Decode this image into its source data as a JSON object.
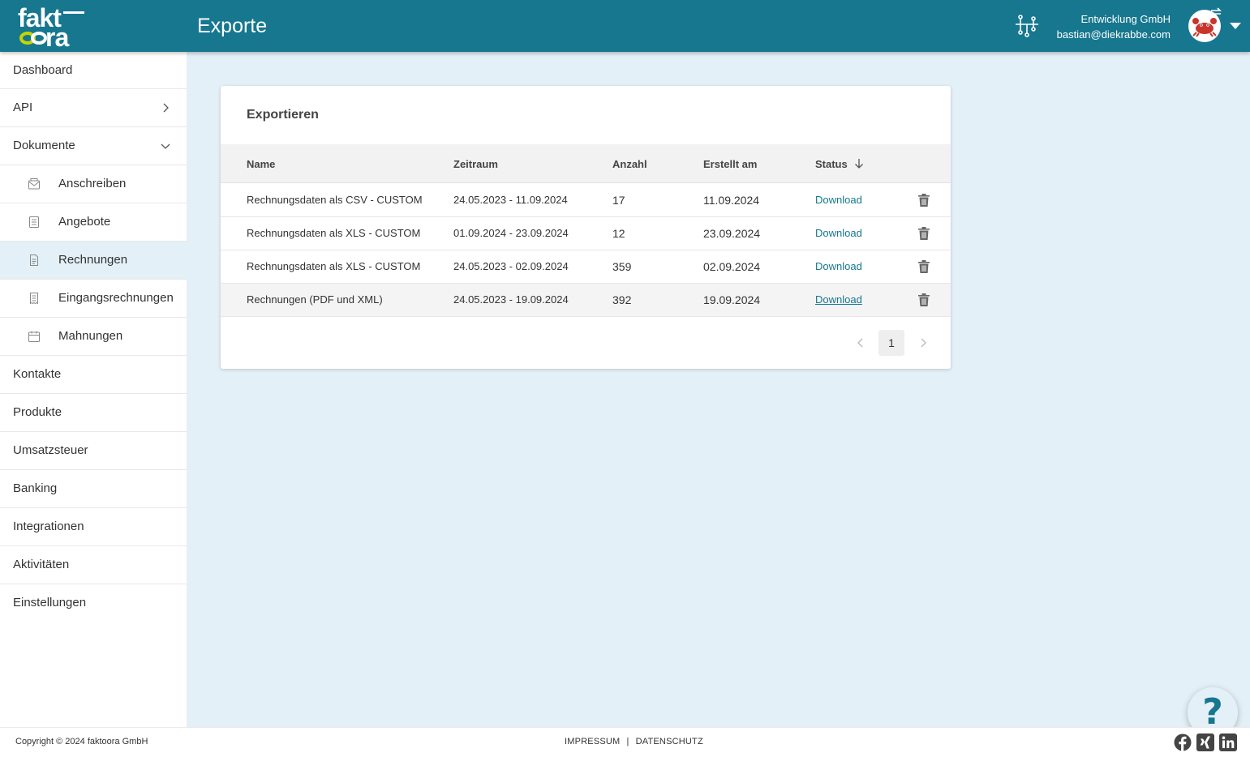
{
  "header": {
    "logo_top": "fakt",
    "logo_bottom": "ra",
    "page_title": "Exporte",
    "company": "Entwicklung GmbH",
    "email": "bastian@diekrabbe.com"
  },
  "sidebar": {
    "items": [
      {
        "label": "Dashboard"
      },
      {
        "label": "API"
      },
      {
        "label": "Dokumente"
      },
      {
        "label": "Anschreiben"
      },
      {
        "label": "Angebote"
      },
      {
        "label": "Rechnungen"
      },
      {
        "label": "Eingangsrechnungen"
      },
      {
        "label": "Mahnungen"
      },
      {
        "label": "Kontakte"
      },
      {
        "label": "Produkte"
      },
      {
        "label": "Umsatzsteuer"
      },
      {
        "label": "Banking"
      },
      {
        "label": "Integrationen"
      },
      {
        "label": "Aktivitäten"
      },
      {
        "label": "Einstellungen"
      }
    ]
  },
  "card": {
    "title": "Exportieren",
    "columns": {
      "name": "Name",
      "zeitraum": "Zeitraum",
      "anzahl": "Anzahl",
      "erstellt": "Erstellt am",
      "status": "Status"
    },
    "rows": [
      {
        "name": "Rechnungsdaten als CSV - CUSTOM",
        "zeitraum": "24.05.2023 - 11.09.2024",
        "anzahl": "17",
        "erstellt": "11.09.2024",
        "status": "Download"
      },
      {
        "name": "Rechnungsdaten als XLS - CUSTOM",
        "zeitraum": "01.09.2024 - 23.09.2024",
        "anzahl": "12",
        "erstellt": "23.09.2024",
        "status": "Download"
      },
      {
        "name": "Rechnungsdaten als XLS - CUSTOM",
        "zeitraum": "24.05.2023 - 02.09.2024",
        "anzahl": "359",
        "erstellt": "02.09.2024",
        "status": "Download"
      },
      {
        "name": "Rechnungen (PDF und XML)",
        "zeitraum": "24.05.2023 - 19.09.2024",
        "anzahl": "392",
        "erstellt": "19.09.2024",
        "status": "Download"
      }
    ],
    "pager": {
      "current_page": "1"
    }
  },
  "footer": {
    "copyright": "Copyright © 2024 faktoora GmbH",
    "impressum": "IMPRESSUM",
    "separator": "|",
    "datenschutz": "DATENSCHUTZ"
  },
  "help": {
    "label": "?"
  },
  "colors": {
    "header_bg": "#16778f",
    "content_bg": "#e3f0f7",
    "link": "#16778f",
    "logo_accent": "#c8d400"
  }
}
